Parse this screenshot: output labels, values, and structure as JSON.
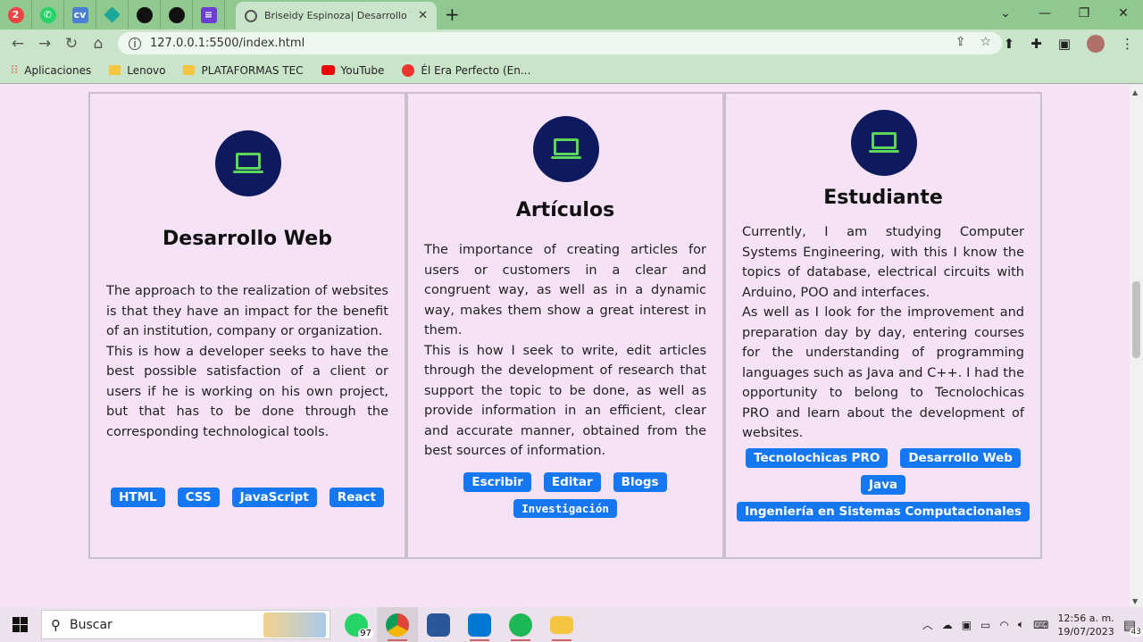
{
  "browser": {
    "tab_title": "Briseidy Espinoza| Desarrollo Web",
    "url": "127.0.0.1:5500/index.html",
    "pinned_badge": "2",
    "bookmarks": [
      {
        "label": "Aplicaciones"
      },
      {
        "label": "Lenovo"
      },
      {
        "label": "PLATAFORMAS TEC"
      },
      {
        "label": "YouTube"
      },
      {
        "label": "Él Era Perfecto (En..."
      }
    ]
  },
  "cards": [
    {
      "title": "Desarrollo Web",
      "text": "The approach to the realization of websites is that they have an impact for the benefit of an institution, company or organization.\nThis is how a developer seeks to have the best possible satisfaction of a client or users if he is working on his own project, but that has to be done through the corresponding technological tools.",
      "tags": [
        "HTML",
        "CSS",
        "JavaScript",
        "React"
      ]
    },
    {
      "title": "Artículos",
      "text": "The importance of creating articles for users or customers in a clear and congruent way, as well as in a dynamic way, makes them show a great interest in them.\nThis is how I seek to write, edit articles through the development of research that support the topic to be done, as well as provide information in an efficient, clear and accurate manner, obtained from the best sources of information.",
      "tags": [
        "Escribir",
        "Editar",
        "Blogs",
        "Investigación"
      ]
    },
    {
      "title": "Estudiante",
      "text": "Currently, I am studying Computer Systems Engineering, with this I know the topics of database, electrical circuits with Arduino, POO and interfaces.\nAs well as I look for the improvement and preparation day by day, entering courses for the understanding of programming languages such as Java and C++. I had the opportunity to belong to Tecnolochicas PRO and learn about the development of websites.",
      "tags": [
        "Tecnolochicas PRO",
        "Desarrollo Web",
        "Java",
        "Ingeniería en Sistemas Computacionales"
      ]
    }
  ],
  "taskbar": {
    "search_placeholder": "Buscar",
    "whatsapp_badge": "97",
    "time": "12:56 a. m.",
    "date": "19/07/2023",
    "notif_count": "43"
  },
  "colors": {
    "page_bg": "#f6e2f6",
    "icon_circle": "#0f1a5e",
    "icon_green": "#5ad65a",
    "tag_blue": "#1677f2",
    "chrome_green": "#8fc98f"
  }
}
